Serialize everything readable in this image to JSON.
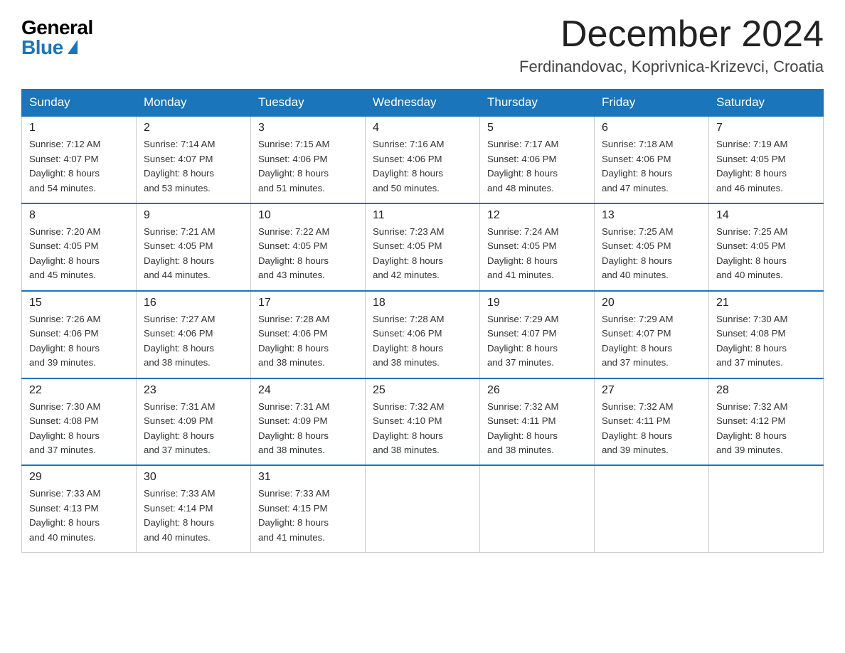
{
  "header": {
    "logo_general": "General",
    "logo_blue": "Blue",
    "month_title": "December 2024",
    "location": "Ferdinandovac, Koprivnica-Krizevci, Croatia"
  },
  "days_of_week": [
    "Sunday",
    "Monday",
    "Tuesday",
    "Wednesday",
    "Thursday",
    "Friday",
    "Saturday"
  ],
  "weeks": [
    [
      {
        "day": "1",
        "sunrise": "7:12 AM",
        "sunset": "4:07 PM",
        "daylight": "8 hours and 54 minutes."
      },
      {
        "day": "2",
        "sunrise": "7:14 AM",
        "sunset": "4:07 PM",
        "daylight": "8 hours and 53 minutes."
      },
      {
        "day": "3",
        "sunrise": "7:15 AM",
        "sunset": "4:06 PM",
        "daylight": "8 hours and 51 minutes."
      },
      {
        "day": "4",
        "sunrise": "7:16 AM",
        "sunset": "4:06 PM",
        "daylight": "8 hours and 50 minutes."
      },
      {
        "day": "5",
        "sunrise": "7:17 AM",
        "sunset": "4:06 PM",
        "daylight": "8 hours and 48 minutes."
      },
      {
        "day": "6",
        "sunrise": "7:18 AM",
        "sunset": "4:06 PM",
        "daylight": "8 hours and 47 minutes."
      },
      {
        "day": "7",
        "sunrise": "7:19 AM",
        "sunset": "4:05 PM",
        "daylight": "8 hours and 46 minutes."
      }
    ],
    [
      {
        "day": "8",
        "sunrise": "7:20 AM",
        "sunset": "4:05 PM",
        "daylight": "8 hours and 45 minutes."
      },
      {
        "day": "9",
        "sunrise": "7:21 AM",
        "sunset": "4:05 PM",
        "daylight": "8 hours and 44 minutes."
      },
      {
        "day": "10",
        "sunrise": "7:22 AM",
        "sunset": "4:05 PM",
        "daylight": "8 hours and 43 minutes."
      },
      {
        "day": "11",
        "sunrise": "7:23 AM",
        "sunset": "4:05 PM",
        "daylight": "8 hours and 42 minutes."
      },
      {
        "day": "12",
        "sunrise": "7:24 AM",
        "sunset": "4:05 PM",
        "daylight": "8 hours and 41 minutes."
      },
      {
        "day": "13",
        "sunrise": "7:25 AM",
        "sunset": "4:05 PM",
        "daylight": "8 hours and 40 minutes."
      },
      {
        "day": "14",
        "sunrise": "7:25 AM",
        "sunset": "4:05 PM",
        "daylight": "8 hours and 40 minutes."
      }
    ],
    [
      {
        "day": "15",
        "sunrise": "7:26 AM",
        "sunset": "4:06 PM",
        "daylight": "8 hours and 39 minutes."
      },
      {
        "day": "16",
        "sunrise": "7:27 AM",
        "sunset": "4:06 PM",
        "daylight": "8 hours and 38 minutes."
      },
      {
        "day": "17",
        "sunrise": "7:28 AM",
        "sunset": "4:06 PM",
        "daylight": "8 hours and 38 minutes."
      },
      {
        "day": "18",
        "sunrise": "7:28 AM",
        "sunset": "4:06 PM",
        "daylight": "8 hours and 38 minutes."
      },
      {
        "day": "19",
        "sunrise": "7:29 AM",
        "sunset": "4:07 PM",
        "daylight": "8 hours and 37 minutes."
      },
      {
        "day": "20",
        "sunrise": "7:29 AM",
        "sunset": "4:07 PM",
        "daylight": "8 hours and 37 minutes."
      },
      {
        "day": "21",
        "sunrise": "7:30 AM",
        "sunset": "4:08 PM",
        "daylight": "8 hours and 37 minutes."
      }
    ],
    [
      {
        "day": "22",
        "sunrise": "7:30 AM",
        "sunset": "4:08 PM",
        "daylight": "8 hours and 37 minutes."
      },
      {
        "day": "23",
        "sunrise": "7:31 AM",
        "sunset": "4:09 PM",
        "daylight": "8 hours and 37 minutes."
      },
      {
        "day": "24",
        "sunrise": "7:31 AM",
        "sunset": "4:09 PM",
        "daylight": "8 hours and 38 minutes."
      },
      {
        "day": "25",
        "sunrise": "7:32 AM",
        "sunset": "4:10 PM",
        "daylight": "8 hours and 38 minutes."
      },
      {
        "day": "26",
        "sunrise": "7:32 AM",
        "sunset": "4:11 PM",
        "daylight": "8 hours and 38 minutes."
      },
      {
        "day": "27",
        "sunrise": "7:32 AM",
        "sunset": "4:11 PM",
        "daylight": "8 hours and 39 minutes."
      },
      {
        "day": "28",
        "sunrise": "7:32 AM",
        "sunset": "4:12 PM",
        "daylight": "8 hours and 39 minutes."
      }
    ],
    [
      {
        "day": "29",
        "sunrise": "7:33 AM",
        "sunset": "4:13 PM",
        "daylight": "8 hours and 40 minutes."
      },
      {
        "day": "30",
        "sunrise": "7:33 AM",
        "sunset": "4:14 PM",
        "daylight": "8 hours and 40 minutes."
      },
      {
        "day": "31",
        "sunrise": "7:33 AM",
        "sunset": "4:15 PM",
        "daylight": "8 hours and 41 minutes."
      },
      null,
      null,
      null,
      null
    ]
  ],
  "labels": {
    "sunrise": "Sunrise:",
    "sunset": "Sunset:",
    "daylight": "Daylight:"
  }
}
